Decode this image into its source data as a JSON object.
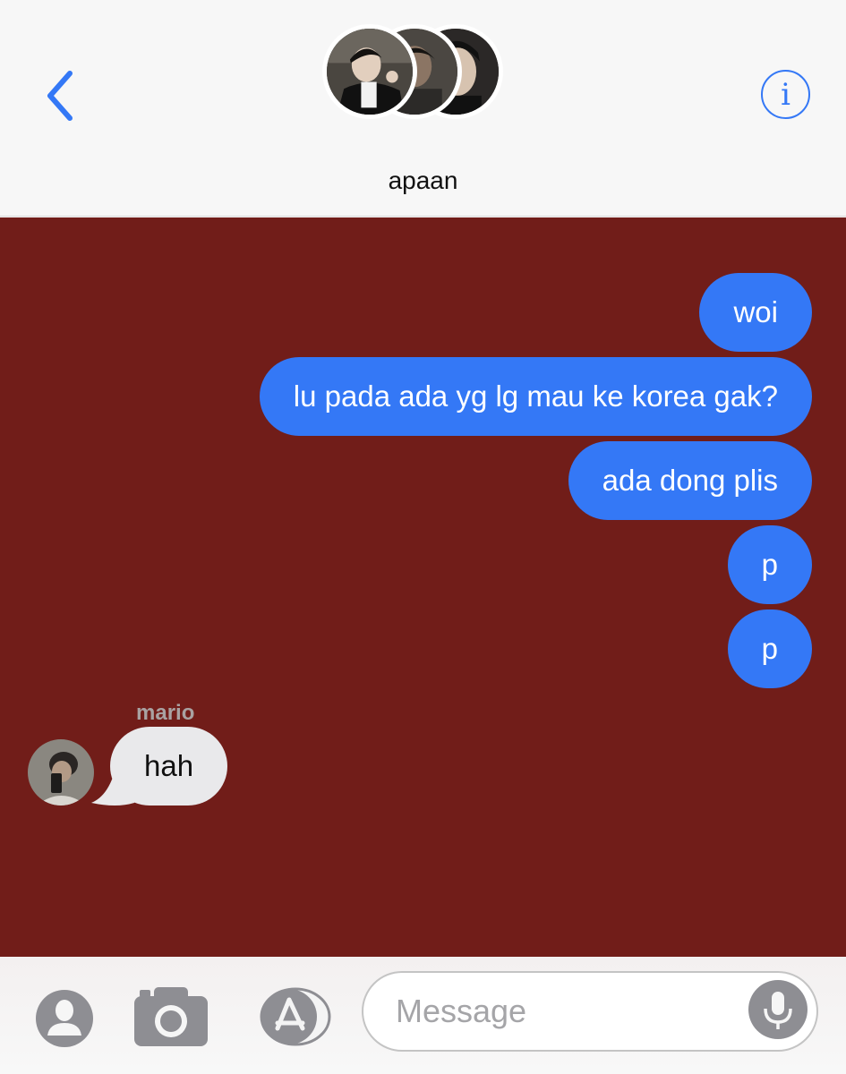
{
  "header": {
    "group_name": "apaan",
    "back_icon": "chevron-left-icon",
    "info_icon": "info-icon",
    "info_glyph": "i",
    "accent_color": "#3478f6"
  },
  "chat": {
    "background_color": "#711d19",
    "outgoing": [
      {
        "text": "woi"
      },
      {
        "text": "lu pada ada yg lg mau ke korea gak?"
      },
      {
        "text": "ada dong plis"
      },
      {
        "text": "p"
      },
      {
        "text": "p"
      }
    ],
    "incoming": {
      "sender": "mario",
      "text": "hah"
    }
  },
  "composer": {
    "placeholder": "Message",
    "icons": [
      "contact-icon",
      "camera-icon",
      "app-store-icon",
      "microphone-icon"
    ]
  }
}
